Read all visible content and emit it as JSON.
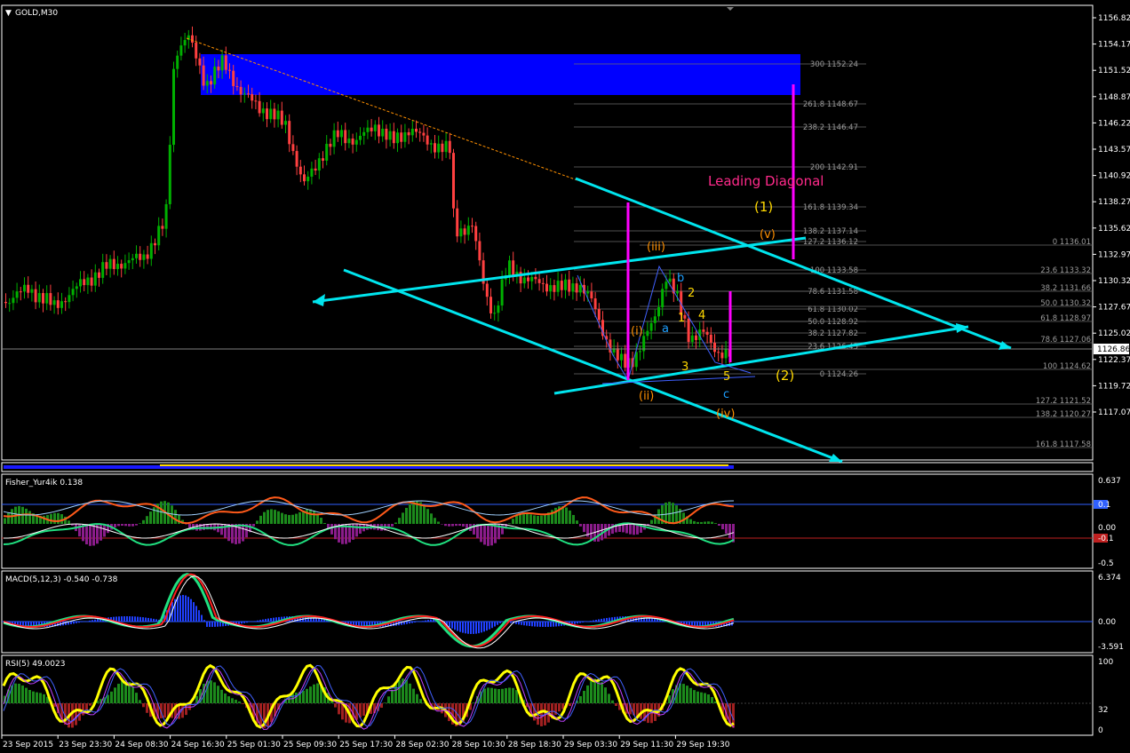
{
  "window": {
    "title": "GOLD,M30",
    "menu_glyph": "▼"
  },
  "main": {
    "price_labels": [
      "1156.82",
      "1154.17",
      "1151.52",
      "1148.87",
      "1146.22",
      "1143.57",
      "1140.92",
      "1138.27",
      "1135.62",
      "1132.97",
      "1130.32",
      "1127.67",
      "1125.02",
      "1122.37",
      "1119.72",
      "1117.07"
    ],
    "current_price": "1126.86",
    "fib_levels": [
      {
        "label": "300  1152.24"
      },
      {
        "label": "261.8  1148.67"
      },
      {
        "label": "238.2  1146.47"
      },
      {
        "label": "200  1142.91"
      },
      {
        "label": "161.8  1139.34"
      },
      {
        "label": "138.2  1137.14"
      },
      {
        "label": "127.2  1136.12"
      },
      {
        "label": "100  1133.58"
      },
      {
        "label": "78.6  1131.58"
      },
      {
        "label": "61.8  1130.02"
      },
      {
        "label": "50.0  1128.92"
      },
      {
        "label": "38.2  1127.82"
      },
      {
        "label": "23.6  1126.45"
      },
      {
        "label": "0  1124.26"
      }
    ],
    "fib_levels_right": [
      {
        "label": "0  1136.01"
      },
      {
        "label": "23.6  1133.32"
      },
      {
        "label": "38.2  1131.66"
      },
      {
        "label": "50.0  1130.32"
      },
      {
        "label": "61.8  1128.97"
      },
      {
        "label": "78.6  1127.06"
      },
      {
        "label": "100  1124.62"
      },
      {
        "label": "127.2  1121.52"
      },
      {
        "label": "138.2  1120.27"
      },
      {
        "label": "161.8  1117.58"
      }
    ],
    "annotations": {
      "leading_diagonal": "Leading Diagonal",
      "w1": "(1)",
      "w2": "(2)",
      "wi": "(i)",
      "wii": "(ii)",
      "wiii": "(iii)",
      "wiv": "(iv)",
      "wv": "(v)",
      "a": "a",
      "b": "b",
      "c": "c",
      "n1": "1",
      "n2": "2",
      "n3": "3",
      "n4": "4",
      "n5": "5"
    },
    "colors": {
      "up": "#00b000",
      "down": "#ff4040",
      "channel": "#00e5ee",
      "zone": "#0000ff",
      "magenta": "#ff00ff",
      "orange": "#ff9000",
      "yellow": "#ffd800",
      "blue_label": "#1e9fff"
    }
  },
  "fisher": {
    "title": "Fisher_Yur4ik 0.138",
    "labels": [
      "0.637",
      "0.1",
      "0.00",
      "-0.1",
      "-0.5"
    ]
  },
  "macd": {
    "title": "MACD(5,12,3) -0.540 -0.738",
    "labels": [
      "6.374",
      "0.00",
      "-3.591"
    ]
  },
  "rsi": {
    "title": "RSI(5) 49.0023",
    "labels": [
      "100",
      "32",
      "0"
    ]
  },
  "time_axis": [
    "23 Sep 2015",
    "23 Sep 23:30",
    "24 Sep 08:30",
    "24 Sep 16:30",
    "25 Sep 01:30",
    "25 Sep 09:30",
    "25 Sep 17:30",
    "28 Sep 02:30",
    "28 Sep 10:30",
    "28 Sep 18:30",
    "29 Sep 03:30",
    "29 Sep 11:30",
    "29 Sep 19:30"
  ]
}
